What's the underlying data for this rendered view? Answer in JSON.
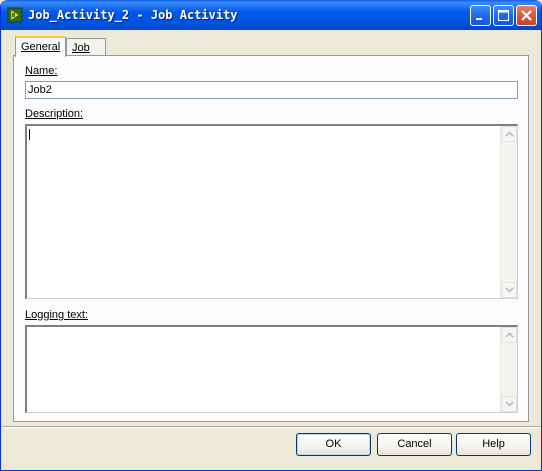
{
  "window": {
    "title": "Job_Activity_2 - Job Activity"
  },
  "tabs": [
    {
      "label": "General"
    },
    {
      "label": "Job"
    }
  ],
  "form": {
    "name_label": "Name:",
    "name_value": "Job2",
    "description_label": "Description:",
    "description_value": "",
    "logging_label": "Logging text:",
    "logging_value": ""
  },
  "buttons": {
    "ok": "OK",
    "cancel": "Cancel",
    "help": "Help"
  },
  "icons": {
    "app": "job-activity-icon",
    "minimize": "minimize-icon",
    "maximize": "maximize-icon",
    "close": "close-icon",
    "scroll_up": "scroll-up-arrow-icon",
    "scroll_down": "scroll-down-arrow-icon"
  },
  "colors": {
    "titlebar": "#0054e3",
    "dialog_bg": "#ece9d8",
    "close_button": "#d75a3c",
    "tab_highlight": "#ffc83c"
  }
}
